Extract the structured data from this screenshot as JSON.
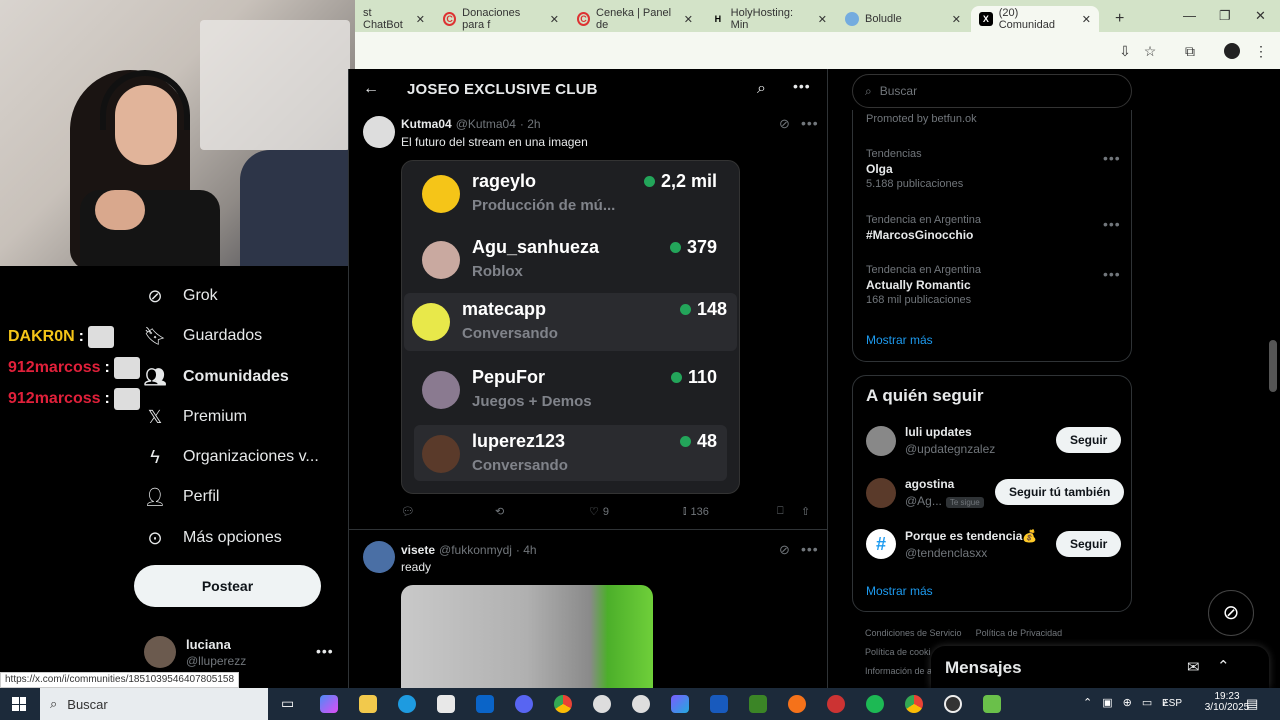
{
  "browser": {
    "tabs": [
      {
        "label": "st ChatBot",
        "fav": ""
      },
      {
        "label": "Donaciones para f",
        "fav": "C"
      },
      {
        "label": "Ceneka | Panel de",
        "fav": "C"
      },
      {
        "label": "HolyHosting: Min",
        "fav": "H"
      },
      {
        "label": "Boludle",
        "fav": ""
      },
      {
        "label": "(20) Comunidad",
        "fav": "X"
      }
    ],
    "new_tab": "+",
    "status_url": "https://x.com/i/communities/1851039546407805158"
  },
  "stream_chat": [
    {
      "user": "DAKR0N",
      "color": "#f5c518"
    },
    {
      "user": "912marcoss",
      "color": "#e0203a"
    },
    {
      "user": "912marcoss",
      "color": "#e0203a"
    }
  ],
  "nav": {
    "items": [
      {
        "label": "Grok",
        "icon": "grok-icon"
      },
      {
        "label": "Guardados",
        "icon": "bookmark-icon"
      },
      {
        "label": "Comunidades",
        "icon": "communities-icon"
      },
      {
        "label": "Premium",
        "icon": "x-logo-icon"
      },
      {
        "label": "Organizaciones v...",
        "icon": "lightning-icon"
      },
      {
        "label": "Perfil",
        "icon": "person-icon"
      },
      {
        "label": "Más opciones",
        "icon": "more-circle-icon"
      }
    ],
    "post_button": "Postear",
    "account": {
      "name": "luciana",
      "handle": "@lluperezz"
    }
  },
  "community": {
    "title": "JOSEO EXCLUSIVE CLUB"
  },
  "posts": [
    {
      "name": "Kutma04",
      "handle": "@Kutma04",
      "time": "· 2h",
      "text": "El futuro del stream en una imagen",
      "likes": "9",
      "views": "136"
    },
    {
      "name": "visete",
      "handle": "@fukkonmydj",
      "time": "· 4h",
      "text": "ready"
    }
  ],
  "embed_rows": [
    {
      "name": "rageylo",
      "activity": "Producción de mú...",
      "count": "2,2 mil",
      "color": "#f5c518"
    },
    {
      "name": "Agu_sanhueza",
      "activity": "Roblox",
      "count": "379",
      "color": "#c9a9a0"
    },
    {
      "name": "matecapp",
      "activity": "Conversando",
      "count": "148",
      "color": "#e8e84a"
    },
    {
      "name": "PepuFor",
      "activity": "Juegos + Demos",
      "count": "110",
      "color": "#8a7a90"
    },
    {
      "name": "luperez123",
      "activity": "Conversando",
      "count": "48",
      "color": "#5a3a2a"
    }
  ],
  "sidebar": {
    "search_placeholder": "Buscar",
    "promoted": "Promoted by betfun.ok",
    "trends": [
      {
        "context": "Tendencias",
        "name": "Olga",
        "count": "5.188 publicaciones"
      },
      {
        "context": "Tendencia en Argentina",
        "name": "#MarcosGinocchio",
        "count": ""
      },
      {
        "context": "Tendencia en Argentina",
        "name": "Actually Romantic",
        "count": "168 mil publicaciones"
      }
    ],
    "show_more": "Mostrar más",
    "who_to_follow_title": "A quién seguir",
    "follow": [
      {
        "name": "luli updates",
        "handle": "@updategnzalez",
        "button": "Seguir",
        "badge": ""
      },
      {
        "name": "agostina",
        "handle": "@Ag...",
        "button": "Seguir tú también",
        "badge": "Te sigue"
      },
      {
        "name": "Porque es tendencia💰",
        "handle": "@tendenclasxx",
        "button": "Seguir",
        "badge": ""
      }
    ],
    "show_more_2": "Mostrar más",
    "footer_links": [
      "Condiciones de Servicio",
      "Política de Privacidad",
      "Política de cooki",
      "Información de a"
    ],
    "messages_title": "Mensajes"
  },
  "taskbar": {
    "search_label": "Buscar",
    "lang": "ESP",
    "time": "19:23",
    "date": "3/10/2025"
  }
}
